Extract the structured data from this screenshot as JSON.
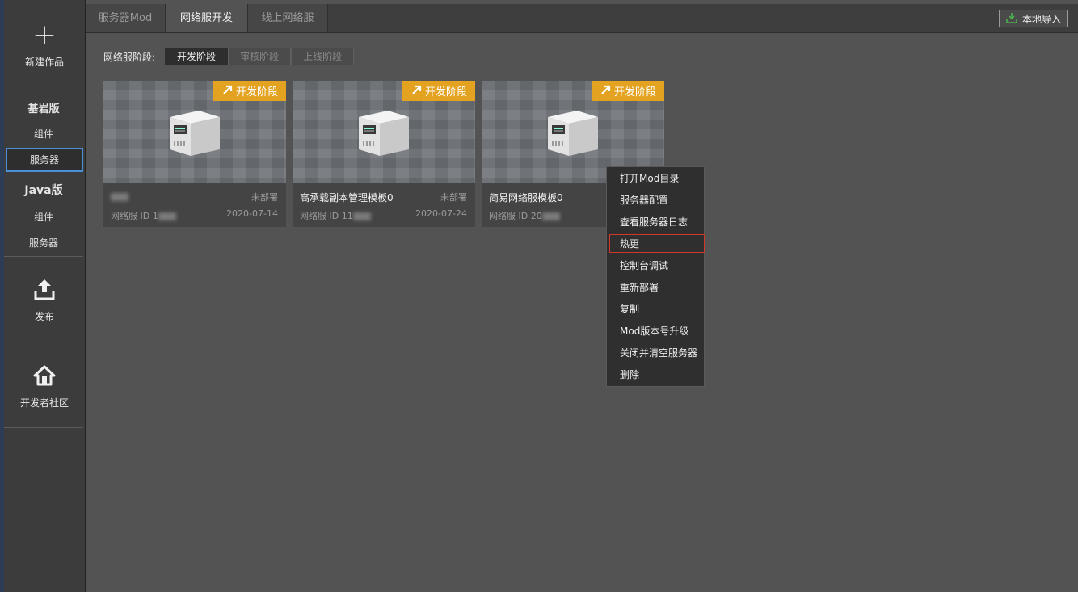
{
  "sidebar": {
    "new_label": "新建作品",
    "bedrock_heading": "基岩版",
    "bedrock_items": [
      "组件",
      "服务器"
    ],
    "java_heading": "Java版",
    "java_items": [
      "组件",
      "服务器"
    ],
    "publish_label": "发布",
    "community_label": "开发者社区"
  },
  "tabs": [
    "服务器Mod",
    "网络服开发",
    "线上网络服"
  ],
  "active_tab": "网络服开发",
  "import_button": "本地导入",
  "stage": {
    "label": "网络服阶段:",
    "options": [
      "开发阶段",
      "审核阶段",
      "上线阶段"
    ],
    "active": "开发阶段"
  },
  "cards": [
    {
      "badge": "开发阶段",
      "name": "",
      "state": "未部署",
      "id_prefix": "网络服 ID 1",
      "date": "2020-07-14"
    },
    {
      "badge": "开发阶段",
      "name": "高承载副本管理模板0",
      "state": "未部署",
      "id_prefix": "网络服 ID 11",
      "date": "2020-07-24"
    },
    {
      "badge": "开发阶段",
      "name": "简易网络服模板0",
      "state": "",
      "id_prefix": "网络服 ID 20",
      "date": ""
    }
  ],
  "context_menu": {
    "items": [
      "打开Mod目录",
      "服务器配置",
      "查看服务器日志",
      "热更",
      "控制台调试",
      "重新部署",
      "复制",
      "Mod版本号升级",
      "关闭并清空服务器",
      "删除"
    ],
    "highlighted": "热更"
  },
  "colors": {
    "badge": "#e3a320",
    "highlight_border": "#d0382b",
    "active_sidebar_border": "#4a90d9"
  }
}
